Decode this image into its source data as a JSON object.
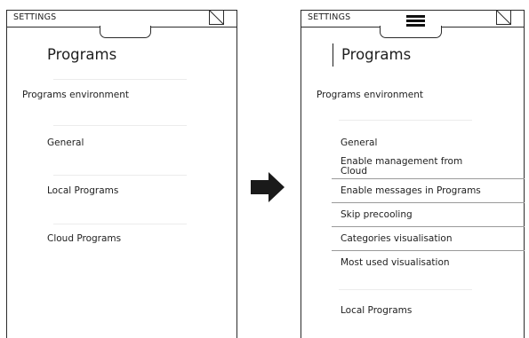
{
  "left_screen": {
    "header_title": "SETTINGS",
    "page_title": "Programs",
    "items": [
      "Programs environment",
      "General",
      "Local Programs",
      "Cloud Programs"
    ]
  },
  "right_screen": {
    "header_title": "SETTINGS",
    "page_title": "Programs",
    "items": [
      "Programs environment",
      "General",
      "Enable management from Cloud",
      "Enable messages in Programs",
      "Skip precooling",
      "Categories visualisation",
      "Most used visualisation",
      "Local Programs"
    ]
  },
  "icons": {
    "close": "close-x-icon",
    "menu": "hamburger-menu-icon",
    "transition": "arrow-right-icon"
  },
  "colors": {
    "outline": "#2b2b2b",
    "text": "#1e1e1e",
    "arrow": "#1a1a1a"
  }
}
